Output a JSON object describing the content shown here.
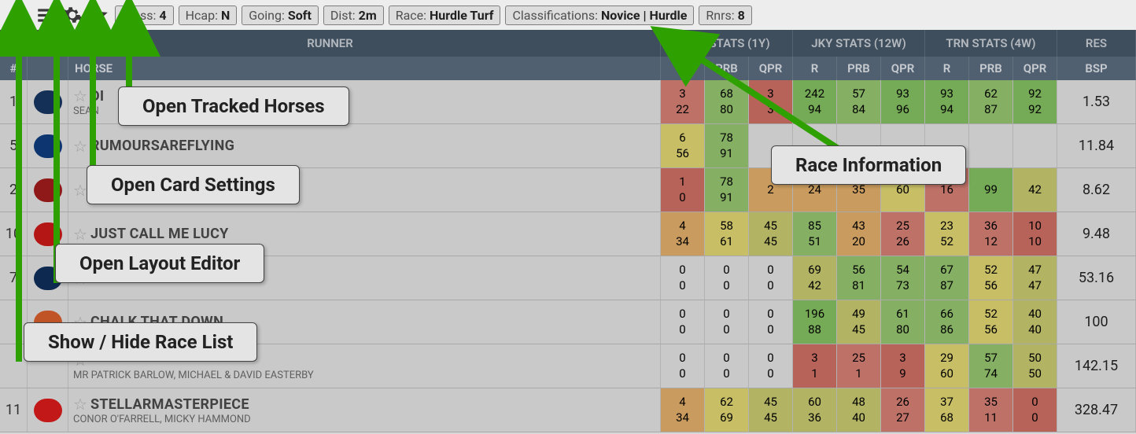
{
  "toolbar": {
    "pills": {
      "class": {
        "label": "Class:",
        "value": "4"
      },
      "hcap": {
        "label": "Hcap:",
        "value": "N"
      },
      "going": {
        "label": "Going:",
        "value": "Soft"
      },
      "dist": {
        "label": "Dist:",
        "value": "2m"
      },
      "race": {
        "label": "Race:",
        "value": "Hurdle Turf"
      },
      "classif": {
        "label": "Classifications:",
        "value": "Novice | Hurdle"
      },
      "rnrs": {
        "label": "Rnrs:",
        "value": "8"
      }
    }
  },
  "headers": {
    "group": [
      "RUNNER",
      "HRS STATS (1Y)",
      "JKY STATS (12W)",
      "TRN STATS (4W)",
      "RES"
    ],
    "cols": [
      "#",
      "",
      "HORSE",
      "R",
      "PRB",
      "QPR",
      "R",
      "PRB",
      "QPR",
      "R",
      "PRB",
      "QPR",
      "BSP"
    ]
  },
  "callouts": {
    "tracked": "Open Tracked Horses",
    "card": "Open Card Settings",
    "layout": "Open Layout Editor",
    "racelist": "Show / Hide Race List",
    "raceinfo": "Race Information"
  },
  "rows": [
    {
      "num": "1",
      "silk": "#17345e",
      "horse": "DI",
      "sub": "SEAN",
      "stats": [
        {
          "v1": "3",
          "v2": "22",
          "c": "c-red"
        },
        {
          "v1": "68",
          "v2": "80",
          "c": "c-green"
        },
        {
          "v1": "3",
          "v2": "3",
          "c": "c-red2"
        },
        {
          "v1": "242",
          "v2": "94",
          "c": "c-green2"
        },
        {
          "v1": "57",
          "v2": "84",
          "c": "c-green"
        },
        {
          "v1": "93",
          "v2": "96",
          "c": "c-green2"
        },
        {
          "v1": "93",
          "v2": "94",
          "c": "c-green2"
        },
        {
          "v1": "62",
          "v2": "87",
          "c": "c-green"
        },
        {
          "v1": "92",
          "v2": "92",
          "c": "c-green2"
        }
      ],
      "bsp": "1.53"
    },
    {
      "num": "5",
      "silk": "#0e3a78",
      "horse": "RUMOURSAREFLYING",
      "sub": "",
      "stats": [
        {
          "v1": "6",
          "v2": "56",
          "c": "c-yellow"
        },
        {
          "v1": "78",
          "v2": "91",
          "c": "c-green"
        },
        {
          "v1": "",
          "v2": "",
          "c": "c-gray"
        },
        {
          "v1": "",
          "v2": "",
          "c": "c-gray"
        },
        {
          "v1": "",
          "v2": "",
          "c": "c-gray"
        },
        {
          "v1": "",
          "v2": "",
          "c": "c-gray"
        },
        {
          "v1": "",
          "v2": "",
          "c": "c-gray"
        },
        {
          "v1": "",
          "v2": "",
          "c": "c-gray"
        },
        {
          "v1": "",
          "v2": "",
          "c": "c-gray"
        }
      ],
      "bsp": "11.84"
    },
    {
      "num": "2",
      "silk": "#9a1b1b",
      "horse": "",
      "sub": "",
      "stats": [
        {
          "v1": "1",
          "v2": "0",
          "c": "c-red2"
        },
        {
          "v1": "78",
          "v2": "91",
          "c": "c-green"
        },
        {
          "v1": "",
          "v2": "2",
          "c": "c-orange"
        },
        {
          "v1": "",
          "v2": "24",
          "c": "c-orange"
        },
        {
          "v1": "",
          "v2": "35",
          "c": "c-orange"
        },
        {
          "v1": "",
          "v2": "60",
          "c": "c-yellow"
        },
        {
          "v1": "",
          "v2": "16",
          "c": "c-red"
        },
        {
          "v1": "",
          "v2": "99",
          "c": "c-green2"
        },
        {
          "v1": "",
          "v2": "42",
          "c": "c-olive"
        }
      ],
      "bsp": "8.62"
    },
    {
      "num": "10",
      "silk": "#c21818",
      "horse": "JUST CALL ME LUCY",
      "sub": "",
      "stats": [
        {
          "v1": "4",
          "v2": "34",
          "c": "c-orange"
        },
        {
          "v1": "58",
          "v2": "61",
          "c": "c-yellow"
        },
        {
          "v1": "45",
          "v2": "45",
          "c": "c-olive"
        },
        {
          "v1": "85",
          "v2": "51",
          "c": "c-green"
        },
        {
          "v1": "43",
          "v2": "20",
          "c": "c-orange"
        },
        {
          "v1": "25",
          "v2": "26",
          "c": "c-red"
        },
        {
          "v1": "23",
          "v2": "52",
          "c": "c-yellow"
        },
        {
          "v1": "36",
          "v2": "12",
          "c": "c-red"
        },
        {
          "v1": "10",
          "v2": "10",
          "c": "c-red2"
        }
      ],
      "bsp": "9.48"
    },
    {
      "num": "7",
      "silk": "#0f2c55",
      "horse": "",
      "sub": "",
      "stats": [
        {
          "v1": "0",
          "v2": "0",
          "c": "c-gray"
        },
        {
          "v1": "0",
          "v2": "0",
          "c": "c-gray"
        },
        {
          "v1": "0",
          "v2": "0",
          "c": "c-gray"
        },
        {
          "v1": "69",
          "v2": "42",
          "c": "c-olive"
        },
        {
          "v1": "56",
          "v2": "81",
          "c": "c-green"
        },
        {
          "v1": "54",
          "v2": "73",
          "c": "c-green"
        },
        {
          "v1": "67",
          "v2": "87",
          "c": "c-green"
        },
        {
          "v1": "52",
          "v2": "56",
          "c": "c-yellow"
        },
        {
          "v1": "47",
          "v2": "47",
          "c": "c-olive"
        }
      ],
      "bsp": "53.16"
    },
    {
      "num": "",
      "silk": "#d05a2a",
      "horse": "CHALK THAT DOWN",
      "sub": "",
      "stats": [
        {
          "v1": "0",
          "v2": "0",
          "c": "c-gray"
        },
        {
          "v1": "0",
          "v2": "0",
          "c": "c-gray"
        },
        {
          "v1": "0",
          "v2": "0",
          "c": "c-gray"
        },
        {
          "v1": "196",
          "v2": "88",
          "c": "c-green2"
        },
        {
          "v1": "49",
          "v2": "45",
          "c": "c-olive"
        },
        {
          "v1": "61",
          "v2": "80",
          "c": "c-green"
        },
        {
          "v1": "66",
          "v2": "86",
          "c": "c-green"
        },
        {
          "v1": "52",
          "v2": "56",
          "c": "c-yellow"
        },
        {
          "v1": "40",
          "v2": "40",
          "c": "c-olive"
        }
      ],
      "bsp": "100"
    },
    {
      "num": "",
      "silk": "#d8d8d8",
      "horse": "",
      "sub": "MR PATRICK BARLOW, MICHAEL & DAVID EASTERBY",
      "stats": [
        {
          "v1": "0",
          "v2": "0",
          "c": "c-gray"
        },
        {
          "v1": "0",
          "v2": "0",
          "c": "c-gray"
        },
        {
          "v1": "0",
          "v2": "0",
          "c": "c-gray"
        },
        {
          "v1": "3",
          "v2": "1",
          "c": "c-red2"
        },
        {
          "v1": "25",
          "v2": "1",
          "c": "c-red"
        },
        {
          "v1": "3",
          "v2": "9",
          "c": "c-red2"
        },
        {
          "v1": "29",
          "v2": "60",
          "c": "c-yellow"
        },
        {
          "v1": "57",
          "v2": "74",
          "c": "c-green"
        },
        {
          "v1": "50",
          "v2": "50",
          "c": "c-olive"
        }
      ],
      "bsp": "142.15"
    },
    {
      "num": "11",
      "silk": "#d11a1a",
      "horse": "STELLARMASTERPIECE",
      "sub": "CONOR O'FARRELL, MICKY HAMMOND",
      "stats": [
        {
          "v1": "4",
          "v2": "34",
          "c": "c-orange"
        },
        {
          "v1": "62",
          "v2": "69",
          "c": "c-yellow"
        },
        {
          "v1": "45",
          "v2": "45",
          "c": "c-olive"
        },
        {
          "v1": "60",
          "v2": "36",
          "c": "c-olive"
        },
        {
          "v1": "48",
          "v2": "40",
          "c": "c-olive"
        },
        {
          "v1": "26",
          "v2": "27",
          "c": "c-red"
        },
        {
          "v1": "37",
          "v2": "68",
          "c": "c-yellow"
        },
        {
          "v1": "35",
          "v2": "11",
          "c": "c-red"
        },
        {
          "v1": "0",
          "v2": "0",
          "c": "c-red2"
        }
      ],
      "bsp": "328.47"
    }
  ]
}
